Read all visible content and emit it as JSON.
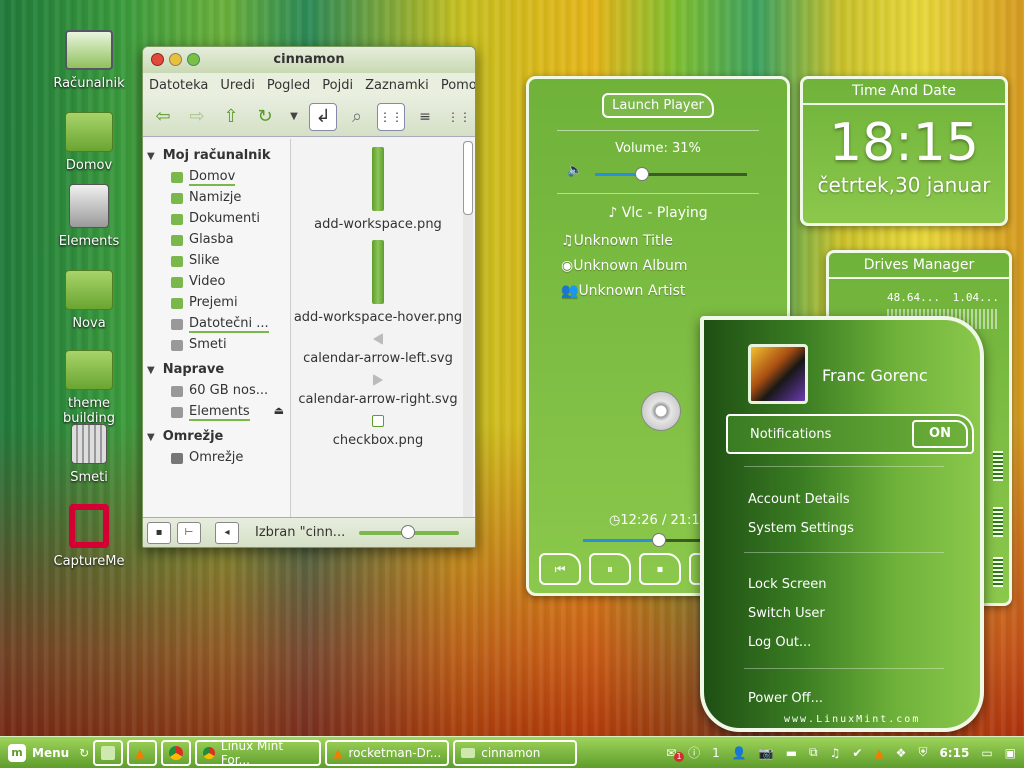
{
  "desktop": {
    "icons": [
      {
        "label": "Računalnik",
        "icon": "computer-icon"
      },
      {
        "label": "Domov",
        "icon": "home-folder-icon"
      },
      {
        "label": "Elements",
        "icon": "drive-icon"
      },
      {
        "label": "Nova",
        "icon": "folder-icon"
      },
      {
        "label": "theme building",
        "icon": "folder-icon"
      },
      {
        "label": "Smeti",
        "icon": "trash-icon"
      },
      {
        "label": "CaptureMe",
        "icon": "debian-swirl-icon"
      }
    ]
  },
  "file_manager": {
    "title": "cinnamon",
    "menu": [
      "Datoteka",
      "Uredi",
      "Pogled",
      "Pojdi",
      "Zaznamki",
      "Pomoč"
    ],
    "sidebar": {
      "sections": [
        {
          "header": "Moj računalnik",
          "items": [
            "Domov",
            "Namizje",
            "Dokumenti",
            "Glasba",
            "Slike",
            "Video",
            "Prejemi",
            "Datotečni ...",
            "Smeti"
          ]
        },
        {
          "header": "Naprave",
          "items": [
            "60 GB nos...",
            "Elements"
          ]
        },
        {
          "header": "Omrežje",
          "items": [
            "Omrežje"
          ]
        }
      ]
    },
    "files": [
      "add-workspace.png",
      "add-workspace-hover.png",
      "calendar-arrow-left.svg",
      "calendar-arrow-right.svg",
      "checkbox.png"
    ],
    "status_text": "Izbran \"cinn..."
  },
  "player": {
    "launch_label": "Launch Player",
    "volume_label": "Volume: 31%",
    "volume": 0.31,
    "app_status": "Vlc - Playing",
    "title": "Unknown Title",
    "album": "Unknown Album",
    "artist": "Unknown Artist",
    "time": "12:26 / 21:12",
    "progress": 0.586
  },
  "clock": {
    "header": "Time And Date",
    "time": "18:15",
    "date": "četrtek,30 januar"
  },
  "drives": {
    "header": "Drives Manager",
    "values": [
      "48.64...",
      "1.04..."
    ]
  },
  "user_menu": {
    "name": "Franc Gorenc",
    "notifications_label": "Notifications",
    "notifications_state": "ON",
    "items": [
      "Account Details",
      "System Settings",
      "Lock Screen",
      "Switch User",
      "Log Out...",
      "Power Off..."
    ],
    "footer": "www.LinuxMint.com"
  },
  "taskbar": {
    "menu_label": "Menu",
    "tasks": [
      "Linux Mint For...",
      "rocketman-Dr...",
      "cinnamon"
    ],
    "tray_notification_count": "1",
    "clock": "6:15"
  },
  "colors": {
    "accent_green": "#6fb23a",
    "volume_blue": "#2b8de0"
  }
}
